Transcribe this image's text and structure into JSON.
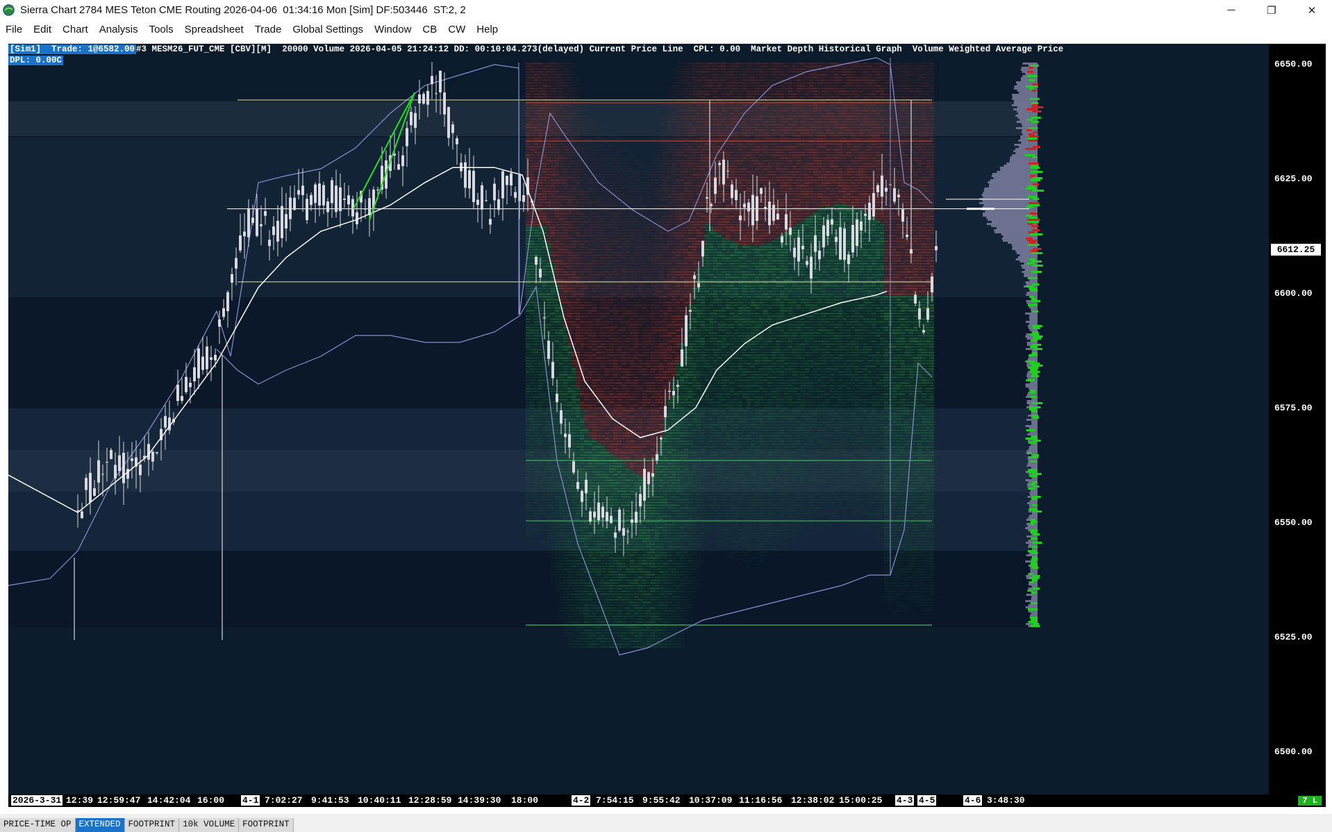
{
  "window": {
    "title": "Sierra Chart 2784 MES Teton CME Routing 2026-04-06  01:34:16 Mon [Sim] DF:503446  ST:2, 2",
    "minimize_glyph": "─",
    "maximize_glyph": "❐",
    "close_glyph": "✕"
  },
  "menu": [
    "File",
    "Edit",
    "Chart",
    "Analysis",
    "Tools",
    "Spreadsheet",
    "Trade",
    "Global Settings",
    "Window",
    "CB",
    "CW",
    "Help"
  ],
  "chart_header": {
    "sim_trade": "[Sim1]  Trade: 1@6582.00",
    "info": "#3 MESM26_FUT_CME [CBV][M]  20000 Volume 2026-04-05 21:24:12 DD: 00:10:04.273(delayed) Current Price Line  CPL: 0.00  Market Depth Historical Graph  Volume Weighted Average Price",
    "dpl": "DPL: 0.00C"
  },
  "price_axis": {
    "labels": [
      "6650.00",
      "6625.00",
      "6600.00",
      "6575.00",
      "6550.00",
      "6525.00",
      "6500.00"
    ],
    "current_price": "6612.25"
  },
  "time_axis": {
    "labels": [
      {
        "text": "2026-3-31",
        "boxed": true
      },
      {
        "text": "12:39",
        "boxed": false
      },
      {
        "text": "12:59:47",
        "boxed": false
      },
      {
        "text": "14:42:04",
        "boxed": false
      },
      {
        "text": "16:00",
        "boxed": false
      },
      {
        "text": "4-1",
        "boxed": true
      },
      {
        "text": "7:02:27",
        "boxed": false
      },
      {
        "text": "9:41:53",
        "boxed": false
      },
      {
        "text": "10:40:11",
        "boxed": false
      },
      {
        "text": "12:28:59",
        "boxed": false
      },
      {
        "text": "14:39:30",
        "boxed": false
      },
      {
        "text": "18:00",
        "boxed": false
      },
      {
        "text": "4-2",
        "boxed": true
      },
      {
        "text": "7:54:15",
        "boxed": false
      },
      {
        "text": "9:55:42",
        "boxed": false
      },
      {
        "text": "10:37:09",
        "boxed": false
      },
      {
        "text": "11:16:56",
        "boxed": false
      },
      {
        "text": "12:38:02",
        "boxed": false
      },
      {
        "text": "15:00:25",
        "boxed": false
      },
      {
        "text": "4-3",
        "boxed": true
      },
      {
        "text": "4-5",
        "boxed": true
      },
      {
        "text": "4-6",
        "boxed": true
      },
      {
        "text": "3:48:30",
        "boxed": false
      }
    ],
    "badge": "7 L"
  },
  "tabs": [
    {
      "label": "PRICE-TIME OP",
      "active": false
    },
    {
      "label": "EXTENDED",
      "active": true
    },
    {
      "label": "FOOTPRINT",
      "active": false
    },
    {
      "label": "10k VOLUME",
      "active": false
    },
    {
      "label": "FOOTPRINT",
      "active": false
    }
  ],
  "colors": {
    "chart_bg": "#0b1b2c",
    "candle": "#d8d8e0",
    "vwap": "#ffffff",
    "bands": "#8a8fd0",
    "ref_line_yellow": "#e8e890",
    "bid_depth": "#2f8a4a",
    "ask_depth": "#a03a30",
    "trendline": "#22dd22",
    "active_tab": "#1a73c9"
  },
  "chart_data": {
    "type": "candlestick",
    "symbol": "MESM26_FUT_CME",
    "price_range": [
      6495,
      6656
    ],
    "current_price": 6612.25,
    "reference_lines": [
      6640,
      6611,
      6591.5
    ]
  }
}
